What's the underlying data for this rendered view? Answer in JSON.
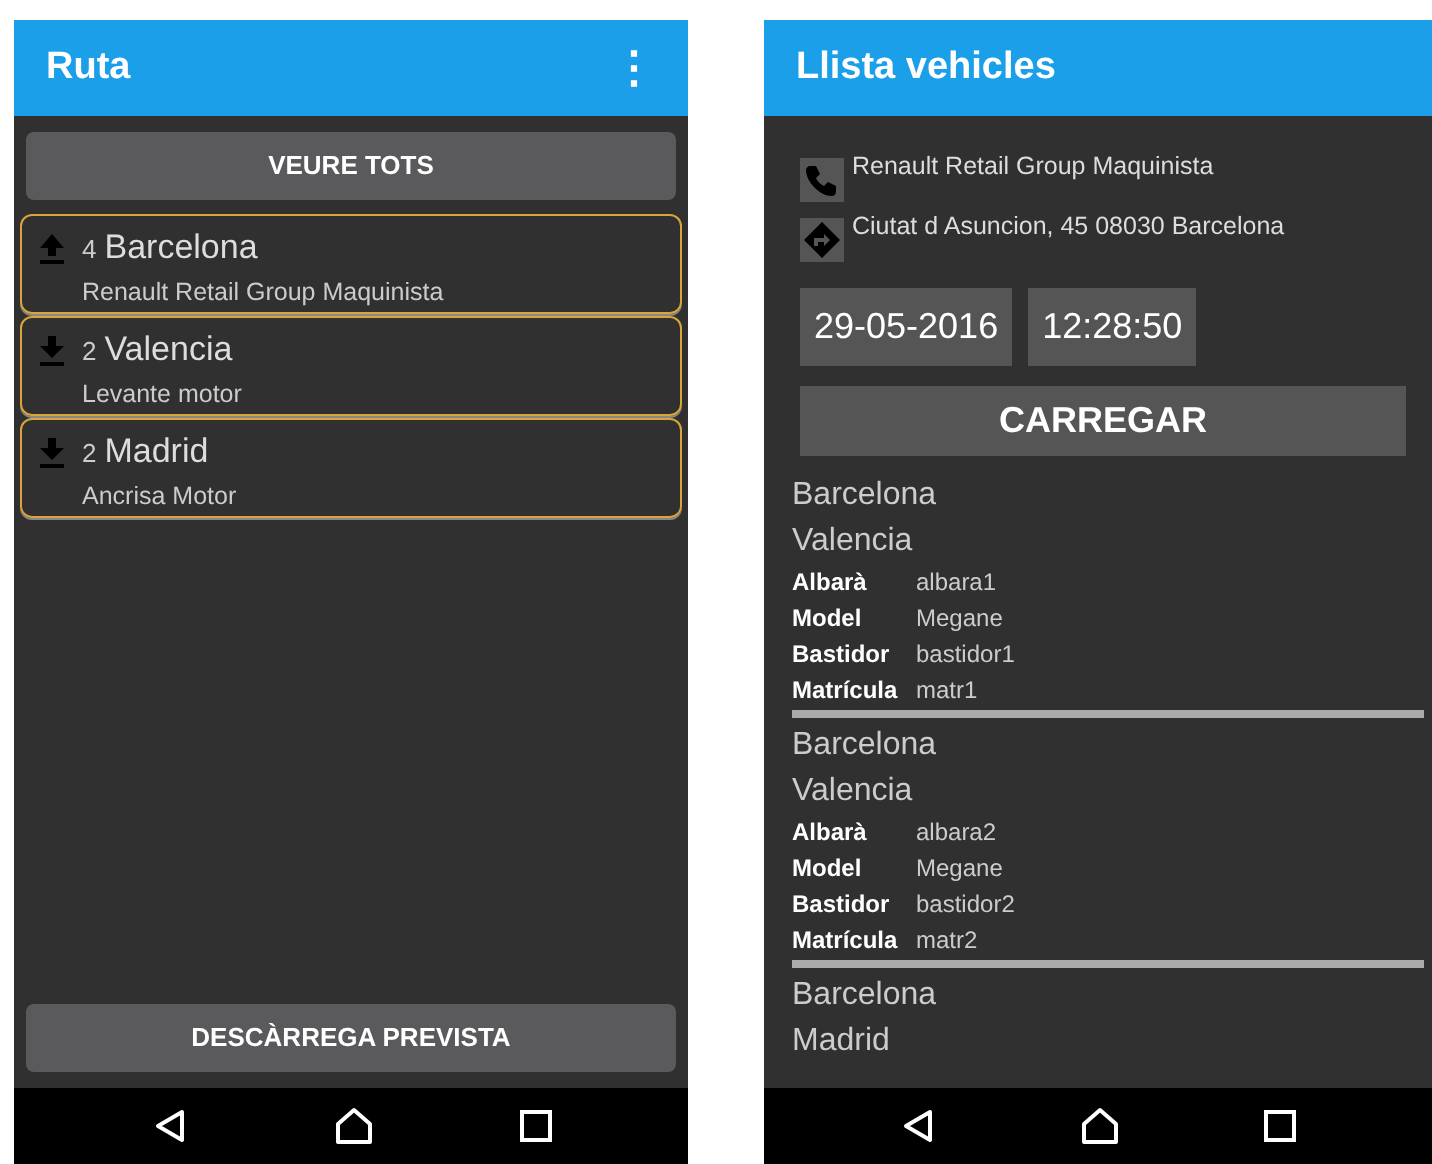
{
  "left_screen": {
    "title": "Ruta",
    "menu_icon": "⋮",
    "top_button": "VEURE TOTS",
    "stops": [
      {
        "kind": "upload",
        "count": "4",
        "city": "Barcelona",
        "company": "Renault Retail Group Maquinista"
      },
      {
        "kind": "download",
        "count": "2",
        "city": "Valencia",
        "company": "Levante motor"
      },
      {
        "kind": "download",
        "count": "2",
        "city": "Madrid",
        "company": "Ancrisa Motor"
      }
    ],
    "bottom_button": "DESCÀRREGA PREVISTA"
  },
  "right_screen": {
    "title": "Llista vehicles",
    "contacts": [
      {
        "kind": "phone",
        "text": "Renault Retail Group Maquinista"
      },
      {
        "kind": "directions",
        "text": "Ciutat d Asuncion, 45 08030 Barcelona"
      }
    ],
    "date": "29-05-2016",
    "time": "12:28:50",
    "load_button": "CARREGAR",
    "entries": [
      {
        "from": "Barcelona",
        "to": "Valencia",
        "fields": [
          {
            "label": "Albarà",
            "value": "albara1"
          },
          {
            "label": "Model",
            "value": "Megane"
          },
          {
            "label": "Bastidor",
            "value": "bastidor1"
          },
          {
            "label": "Matrícula",
            "value": "matr1"
          }
        ]
      },
      {
        "from": "Barcelona",
        "to": "Valencia",
        "fields": [
          {
            "label": "Albarà",
            "value": "albara2"
          },
          {
            "label": "Model",
            "value": "Megane"
          },
          {
            "label": "Bastidor",
            "value": "bastidor2"
          },
          {
            "label": "Matrícula",
            "value": "matr2"
          }
        ]
      },
      {
        "from": "Barcelona",
        "to": "Madrid"
      }
    ]
  }
}
